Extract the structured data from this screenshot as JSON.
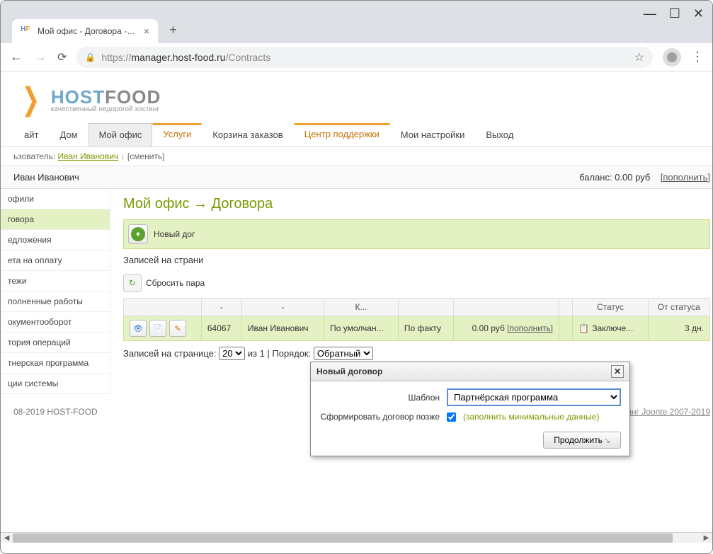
{
  "browser": {
    "tab_title": "Мой офис - Договора - mana…",
    "url_protocol": "https://",
    "url_host": "manager.host-food.ru",
    "url_path": "/Contracts"
  },
  "logo": {
    "text1": "HOST",
    "text2": "FOOD",
    "tag": "качественный недорогой хостинг"
  },
  "topnav": {
    "items": [
      "айт",
      "Дом",
      "Мой офис",
      "Услуги",
      "Корзина заказов",
      "Центр поддержки",
      "Мои настройки",
      "Выход"
    ]
  },
  "userline": {
    "prefix": "ьзователь: ",
    "name": "Иван Иванович",
    "change": "[сменить]"
  },
  "subhead": {
    "left": "Иван Иванович",
    "balance_label": "баланс: ",
    "balance": "0.00 руб",
    "topup": "[пополнить]"
  },
  "sidebar": {
    "items": [
      "офили",
      "говора",
      "едложения",
      "ета на оплату",
      "тежи",
      "полненные работы",
      "окументооборот",
      "тория операций",
      "тнерская программа",
      "ции системы"
    ]
  },
  "breadcrumb": "Мой офис → Договора",
  "newbtn": "Новый дог",
  "recline": "Записей на страни",
  "reset": "Сбросить пара",
  "table": {
    "headers": [
      "",
      "-",
      "-",
      "К...",
      "",
      "",
      "",
      "Статус",
      "От статуса"
    ],
    "row": {
      "num": "64067",
      "name": "Иван Иванович",
      "c1": "По умолчан...",
      "c2": "По факту",
      "amount": "0.00 руб",
      "topup": "[пополнить]",
      "status": "Заключе...",
      "days": "3 дн."
    }
  },
  "pager": {
    "label1": "Записей на странице: ",
    "sel": "20",
    "mid": " из 1 | Порядок: ",
    "sel2": "Обратный"
  },
  "footer": {
    "left": "08-2019 HOST-FOOD",
    "right": "биллинг Joonte 2007-2019"
  },
  "modal": {
    "title": "Новый договор",
    "field_template": "Шаблон",
    "template_value": "Партнёрская программа",
    "field_later": "Сформировать договор позже",
    "hint": "(заполнить минимальные данные)",
    "submit": "Продолжить"
  }
}
